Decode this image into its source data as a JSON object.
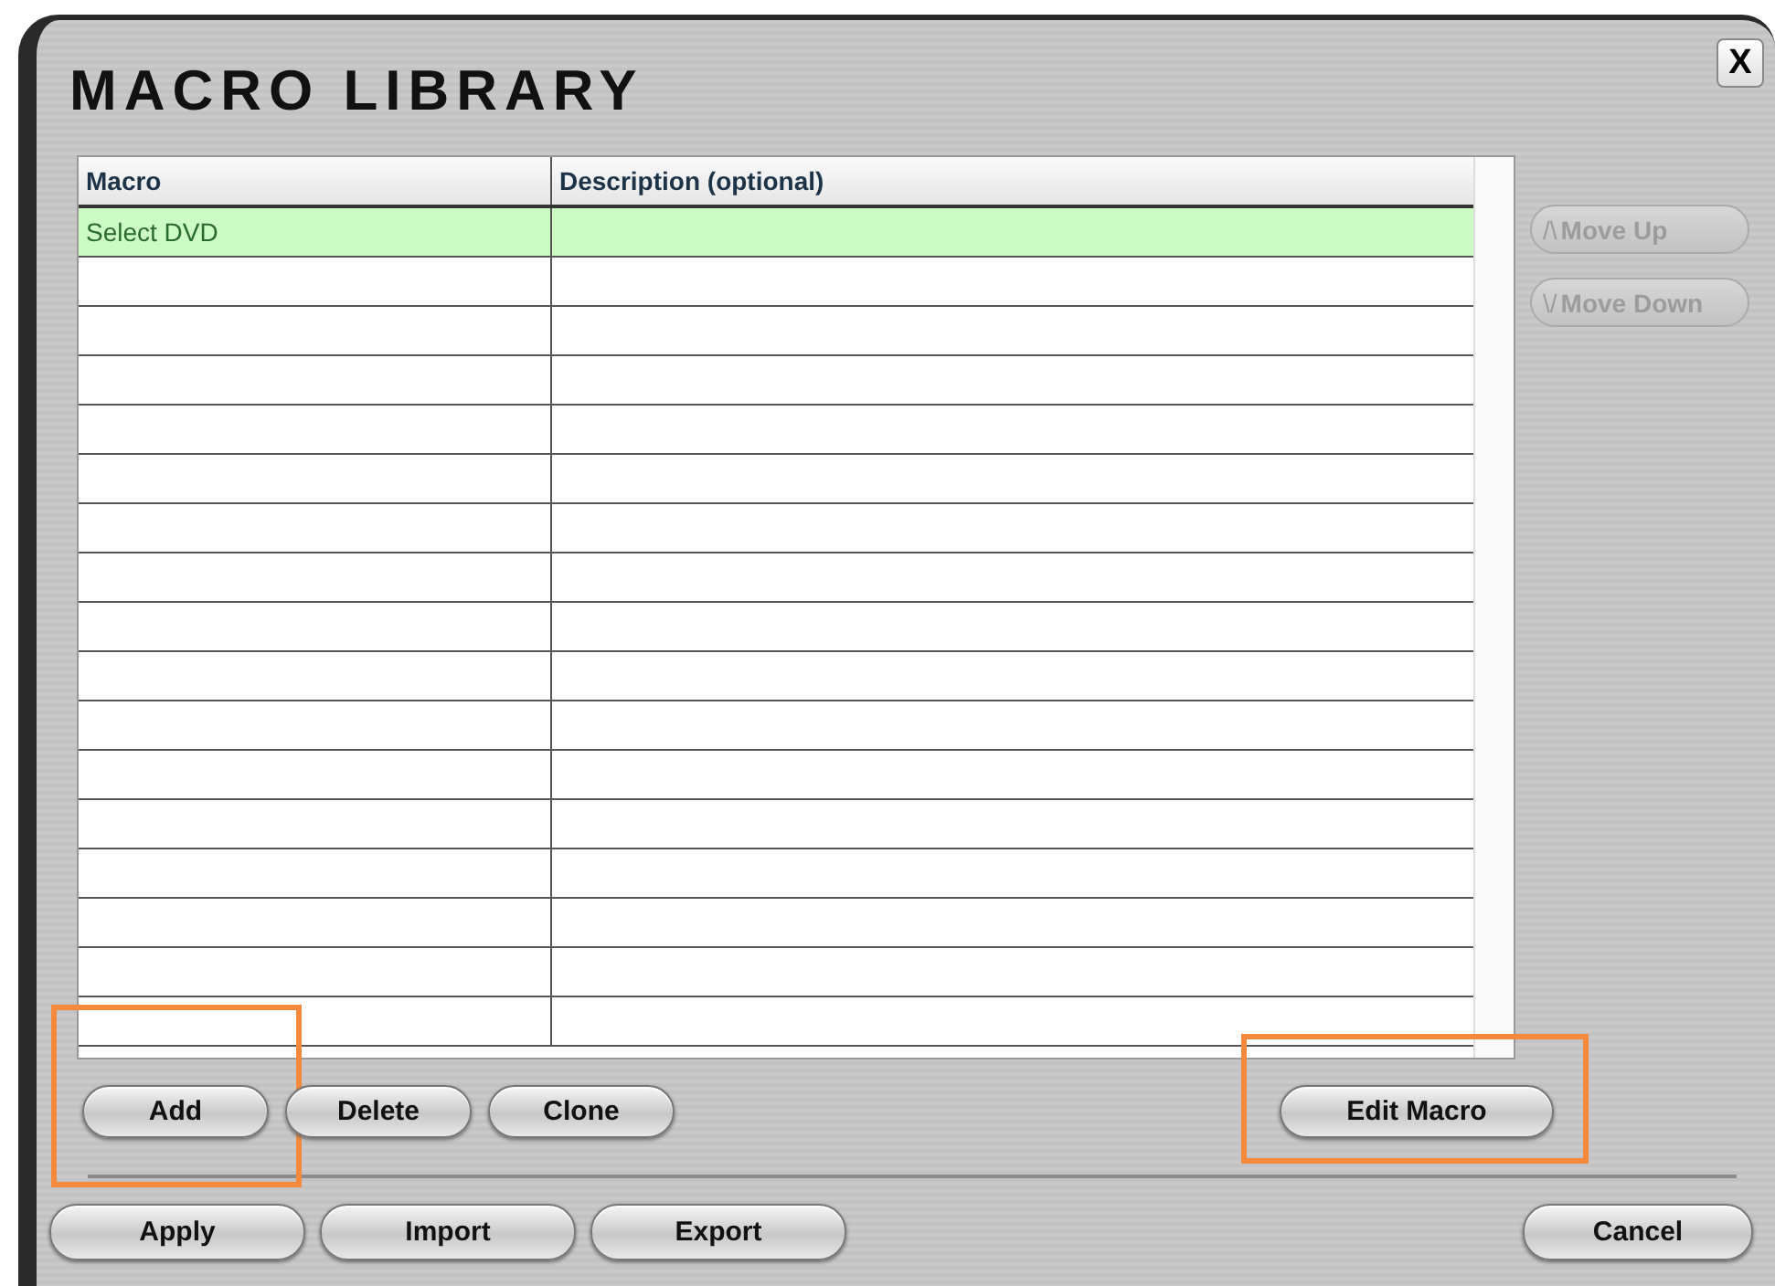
{
  "window": {
    "title": "MACRO LIBRARY",
    "close": "X"
  },
  "table": {
    "columns": [
      "Macro",
      "Description (optional)"
    ],
    "rows": [
      {
        "macro": "Select DVD",
        "selected": true
      }
    ]
  },
  "side_buttons": [
    {
      "label": "Move Up",
      "arrow": "/\\",
      "disabled": true
    },
    {
      "label": "Move Down",
      "arrow": "\\/",
      "disabled": true
    }
  ],
  "actions": [
    {
      "label": "Add",
      "highlighted": true
    },
    {
      "label": "Delete",
      "highlighted": false
    },
    {
      "label": "Clone",
      "highlighted": false
    },
    {
      "label": "Edit Macro",
      "highlighted": true
    }
  ],
  "footer_buttons": [
    {
      "label": "Apply"
    },
    {
      "label": "Import"
    },
    {
      "label": "Export"
    },
    {
      "label": "Cancel"
    }
  ]
}
